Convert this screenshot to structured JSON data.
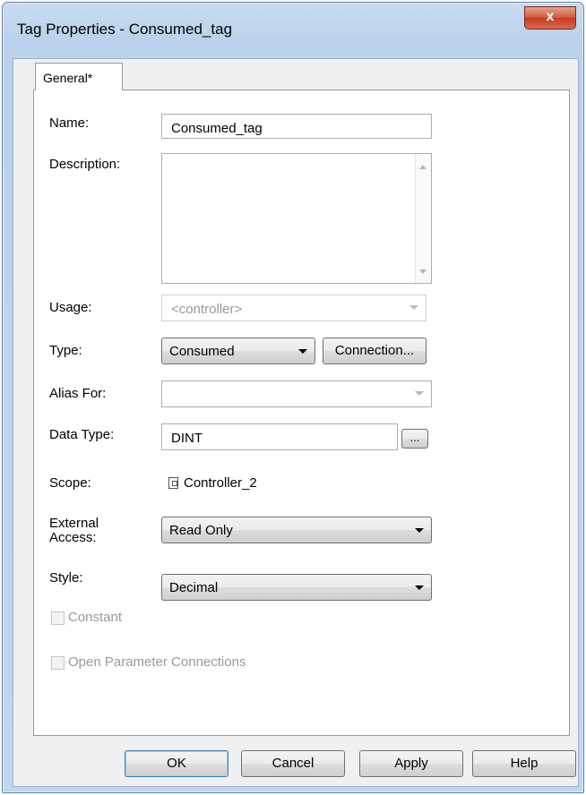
{
  "window": {
    "title": "Tag Properties - Consumed_tag",
    "close_label": "x"
  },
  "tabs": [
    {
      "label": "General*"
    }
  ],
  "form": {
    "name_label": "Name:",
    "name_value": "Consumed_tag",
    "description_label": "Description:",
    "description_value": "",
    "usage_label": "Usage:",
    "usage_value": "<controller>",
    "type_label": "Type:",
    "type_value": "Consumed",
    "connection_button": "Connection...",
    "alias_label": "Alias For:",
    "alias_value": "",
    "datatype_label": "Data Type:",
    "datatype_value": "DINT",
    "datatype_browse": "...",
    "scope_label": "Scope:",
    "scope_value": "Controller_2",
    "external_access_label_1": "External",
    "external_access_label_2": "Access:",
    "external_access_value": "Read Only",
    "style_label": "Style:",
    "style_value": "Decimal",
    "constant_label": "Constant",
    "constant_checked": false,
    "open_param_label": "Open Parameter Connections",
    "open_param_checked": false
  },
  "buttons": {
    "ok": "OK",
    "cancel": "Cancel",
    "apply": "Apply",
    "help": "Help"
  }
}
